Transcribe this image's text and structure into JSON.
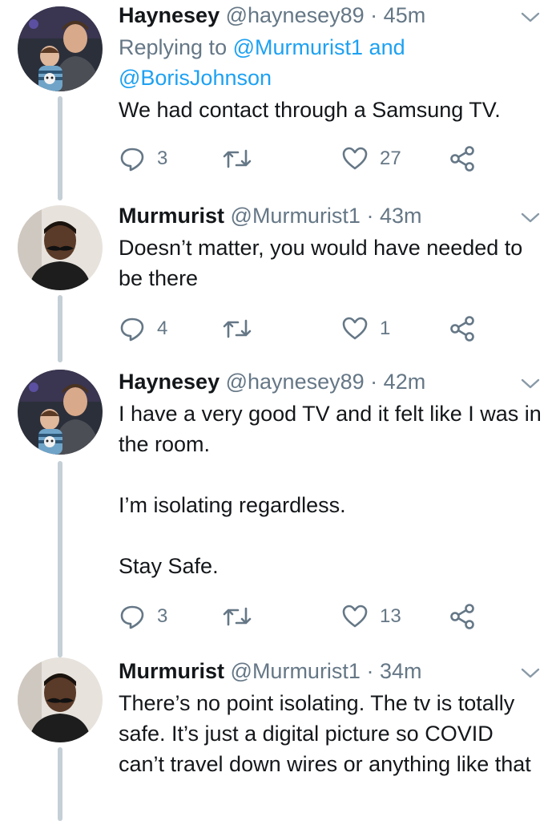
{
  "tweets": [
    {
      "name": "Haynesey",
      "handle": "@haynesey89",
      "time": "45m",
      "reply_prefix": "Replying to",
      "reply_mention_1": "@Murmurist1",
      "reply_and": "and",
      "reply_mention_2": "@BorisJohnson",
      "text": "We had contact through a Samsung TV.",
      "replies": "3",
      "retweets": "",
      "likes": "27"
    },
    {
      "name": "Murmurist",
      "handle": "@Murmurist1",
      "time": "43m",
      "text": "Doesn’t matter, you would have needed to be there",
      "replies": "4",
      "retweets": "",
      "likes": "1"
    },
    {
      "name": "Haynesey",
      "handle": "@haynesey89",
      "time": "42m",
      "text": "I have a very good TV and it felt like I was in the room.\n\nI’m isolating regardless.\n\nStay Safe.",
      "replies": "3",
      "retweets": "",
      "likes": "13"
    },
    {
      "name": "Murmurist",
      "handle": "@Murmurist1",
      "time": "34m",
      "text": "There’s no point isolating. The tv is totally safe. It’s just a digital picture so COVID can’t travel down wires or anything like that"
    }
  ],
  "separator": "·",
  "icons": {
    "reply": "reply-icon",
    "retweet": "retweet-icon",
    "like": "heart-icon",
    "share": "share-icon",
    "caret": "chevron-down-icon"
  },
  "colors": {
    "text": "#14171a",
    "secondary": "#657786",
    "link": "#1da1f2",
    "thread_line": "#c4cfd6"
  }
}
